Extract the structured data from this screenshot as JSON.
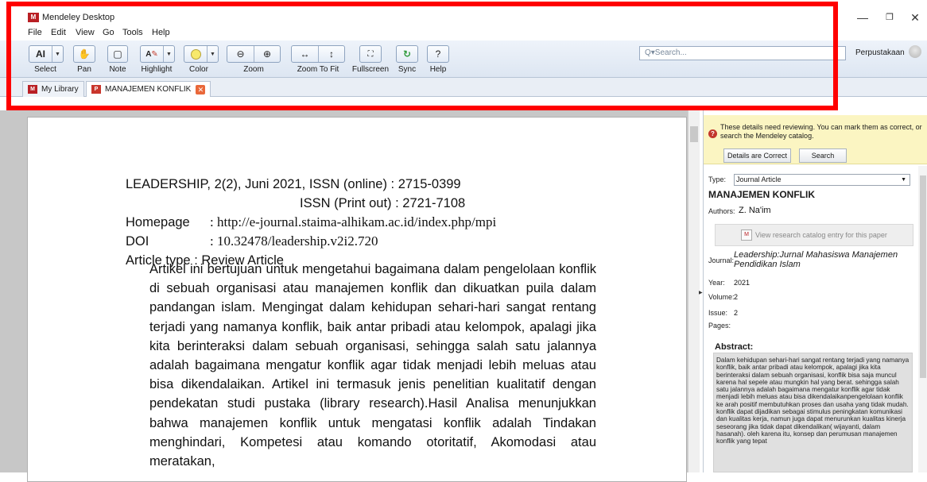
{
  "window": {
    "title": "Mendeley Desktop",
    "min": "—",
    "restore": "❐",
    "close": "✕"
  },
  "menu": [
    "File",
    "Edit",
    "View",
    "Go",
    "Tools",
    "Help"
  ],
  "toolbar": {
    "labels": {
      "select": "Select",
      "pan": "Pan",
      "note": "Note",
      "highlight": "Highlight",
      "color": "Color",
      "zoom": "Zoom",
      "zoom_to_fit": "Zoom To Fit",
      "fullscreen": "Fullscreen",
      "sync": "Sync",
      "help": "Help"
    },
    "highlight_color": "#f7e96b",
    "sync_color": "#2e9a3b"
  },
  "search": {
    "placeholder": "Q▾Search..."
  },
  "account": {
    "name": "Perpustakaan"
  },
  "tabs": [
    {
      "label": "My Library",
      "icon": "library-icon"
    },
    {
      "label": "MANAJEMEN KONFLIK",
      "icon": "pdf-icon",
      "close": "✕"
    }
  ],
  "document": {
    "line1": "LEADERSHIP, 2(2), Juni 2021, ISSN (online)    : 2715-0399",
    "line2": "ISSN (Print out) : 2721-7108",
    "homepage_label": "Homepage",
    "homepage_value": ": http://e-journal.staima-alhikam.ac.id/index.php/mpi",
    "doi_label": "DOI",
    "doi_value": ": 10.32478/leadership.v2i2.720",
    "article_type": "Article type   : Review Article",
    "abstract": "Artikel ini bertujuan untuk mengetahui bagaimana dalam pengelolaan konflik di sebuah organisasi atau manajemen konflik dan dikuatkan puila dalam pandangan islam. Mengingat dalam kehidupan sehari-hari sangat rentang terjadi yang namanya konflik, baik antar pribadi atau kelompok, apalagi jika kita berinteraksi dalam sebuah organisasi, sehingga salah satu jalannya adalah bagaimana mengatur konflik agar tidak menjadi lebih meluas atau bisa dikendalaikan. Artikel ini termasuk jenis penelitian kualitatif dengan pendekatan studi pustaka (library research).Hasil Analisa menunjukkan bahwa manajemen konflik untuk mengatasi konflik adalah Tindakan menghindari, Kompetesi atau komando otoritatif, Akomodasi atau meratakan,"
  },
  "details": {
    "review_message": "These details need reviewing. You can mark them as correct, or search the Mendeley catalog.",
    "details_correct_button": "Details are Correct",
    "search_button": "Search",
    "type_label": "Type:",
    "type_value": "Journal Article",
    "title": "MANAJEMEN KONFLIK",
    "authors_label": "Authors:",
    "authors_value": "Z. Na'im",
    "catalog_button": "View research catalog entry for this paper",
    "journal_label": "Journal:",
    "journal_value": "Leadership:Jurnal Mahasiswa Manajemen Pendidikan Islam",
    "year_label": "Year:",
    "year_value": "2021",
    "volume_label": "Volume:",
    "volume_value": "2",
    "issue_label": "Issue:",
    "issue_value": "2",
    "pages_label": "Pages:",
    "abstract_label": "Abstract:",
    "abstract_text": "Dalam kehidupan sehari-hari sangat rentang terjadi yang namanya konflik, baik antar pribadi atau kelompok, apalagi jika kita berinteraksi dalam sebuah organisasi, konflik bisa saja muncul karena hal sepele atau mungkin hal yang berat. sehingga salah satu jalannya adalah bagaimana mengatur konflik agar tidak menjadi lebih meluas atau bisa dikendalaikanpengelolaan konflik ke arah positif membutuhkan proses dan usaha yang tidak mudah. konflik dapat dijadikan sebagai stimulus peningkatan komunikasi dan kualitas kerja, namun juga dapat menurunkan kualitas kinerja seseorang jika tidak dapat dikendalikan( wijayanti, dalam hasanah). oleh karena itu, konsep dan perumusan manajemen konflik yang tepat"
  },
  "colors": {
    "accent_highlight": "#ff0000",
    "brand": "#b91f24",
    "review_banner": "#fbf5c2"
  }
}
